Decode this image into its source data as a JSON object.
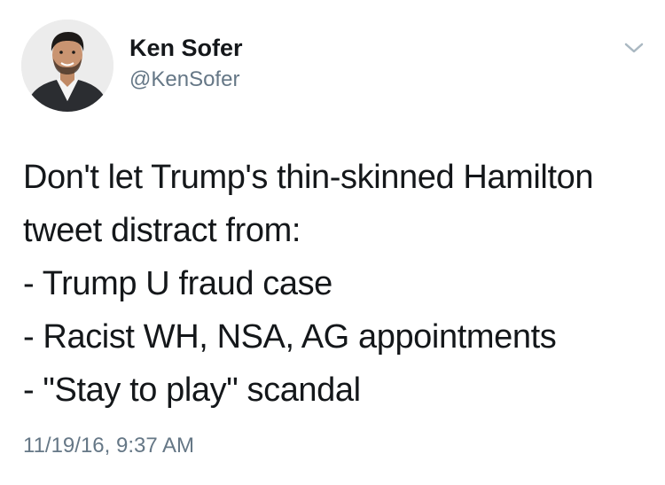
{
  "author": {
    "display_name": "Ken Sofer",
    "handle": "@KenSofer",
    "avatar_icon": "profile-photo"
  },
  "tweet": {
    "lines": [
      "Don't let Trump's thin-skinned Hamilton",
      "tweet distract from:",
      "- Trump U fraud case",
      "- Racist WH, NSA, AG appointments",
      "- \"Stay to play\" scandal"
    ],
    "timestamp": "11/19/16, 9:37 AM"
  },
  "menu": {
    "icon": "chevron-down-icon"
  },
  "colors": {
    "text": "#14171a",
    "secondary": "#657786",
    "caret": "#aab8c2"
  }
}
